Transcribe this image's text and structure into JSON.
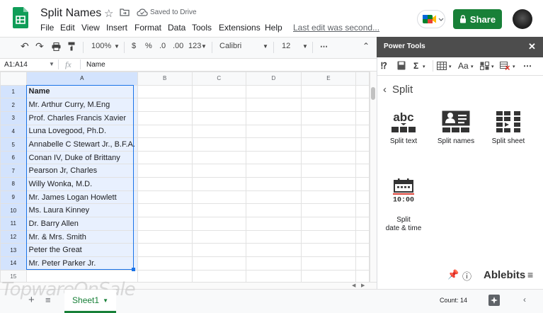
{
  "app": {
    "doc_title": "Split Names",
    "saved_status": "Saved to Drive",
    "menu": [
      "File",
      "Edit",
      "View",
      "Insert",
      "Format",
      "Data",
      "Tools",
      "Extensions",
      "Help"
    ],
    "last_edit": "Last edit was second...",
    "share_label": "Share"
  },
  "toolbar": {
    "zoom": "100%",
    "currency": "$",
    "percent": "%",
    "decrease_decimal": ".0",
    "increase_decimal": ".00",
    "more_formats": "123",
    "font": "Calibri",
    "font_size": "12",
    "more": "⋯"
  },
  "formula_bar": {
    "range": "A1:A14",
    "fx": "fx",
    "value": "Name"
  },
  "grid": {
    "columns": [
      "A",
      "B",
      "C",
      "D",
      "E"
    ],
    "rows": [
      "1",
      "2",
      "3",
      "4",
      "5",
      "6",
      "7",
      "8",
      "9",
      "10",
      "11",
      "12",
      "13",
      "14",
      "15"
    ],
    "cells_a": [
      "Name",
      "Mr. Arthur Curry, M.Eng",
      "Prof. Charles Francis Xavier",
      "Luna Lovegood, Ph.D.",
      "Annabelle C Stewart Jr., B.F.A.",
      "Conan IV, Duke of Brittany",
      "Pearson Jr, Charles",
      "Willy Wonka, M.D.",
      "Mr. James Logan Howlett",
      "Ms. Laura Kinney",
      "Dr. Barry Allen",
      "Mr. & Mrs. Smith",
      "Peter the Great",
      "Mr. Peter Parker Jr.",
      ""
    ]
  },
  "bottom": {
    "sheet_name": "Sheet1",
    "count": "Count: 14",
    "watermark": "TopwareOnSale"
  },
  "panel": {
    "title": "Power Tools",
    "section": "Split",
    "tools": [
      {
        "label": "Split text",
        "icon": "split-text-icon"
      },
      {
        "label": "Split names",
        "icon": "split-names-icon"
      },
      {
        "label": "Split sheet",
        "icon": "split-sheet-icon"
      },
      {
        "label": "Split\ndate & time",
        "icon": "split-date-time-icon"
      }
    ],
    "split_text_icon_label": "abc",
    "date_time_icon_label": "10:00",
    "brand": "Ablebits"
  },
  "colors": {
    "accent_green": "#188038",
    "selection_blue": "#1a73e8",
    "selection_fill": "#e8f0fe",
    "panel_header": "#4d4d4d"
  }
}
